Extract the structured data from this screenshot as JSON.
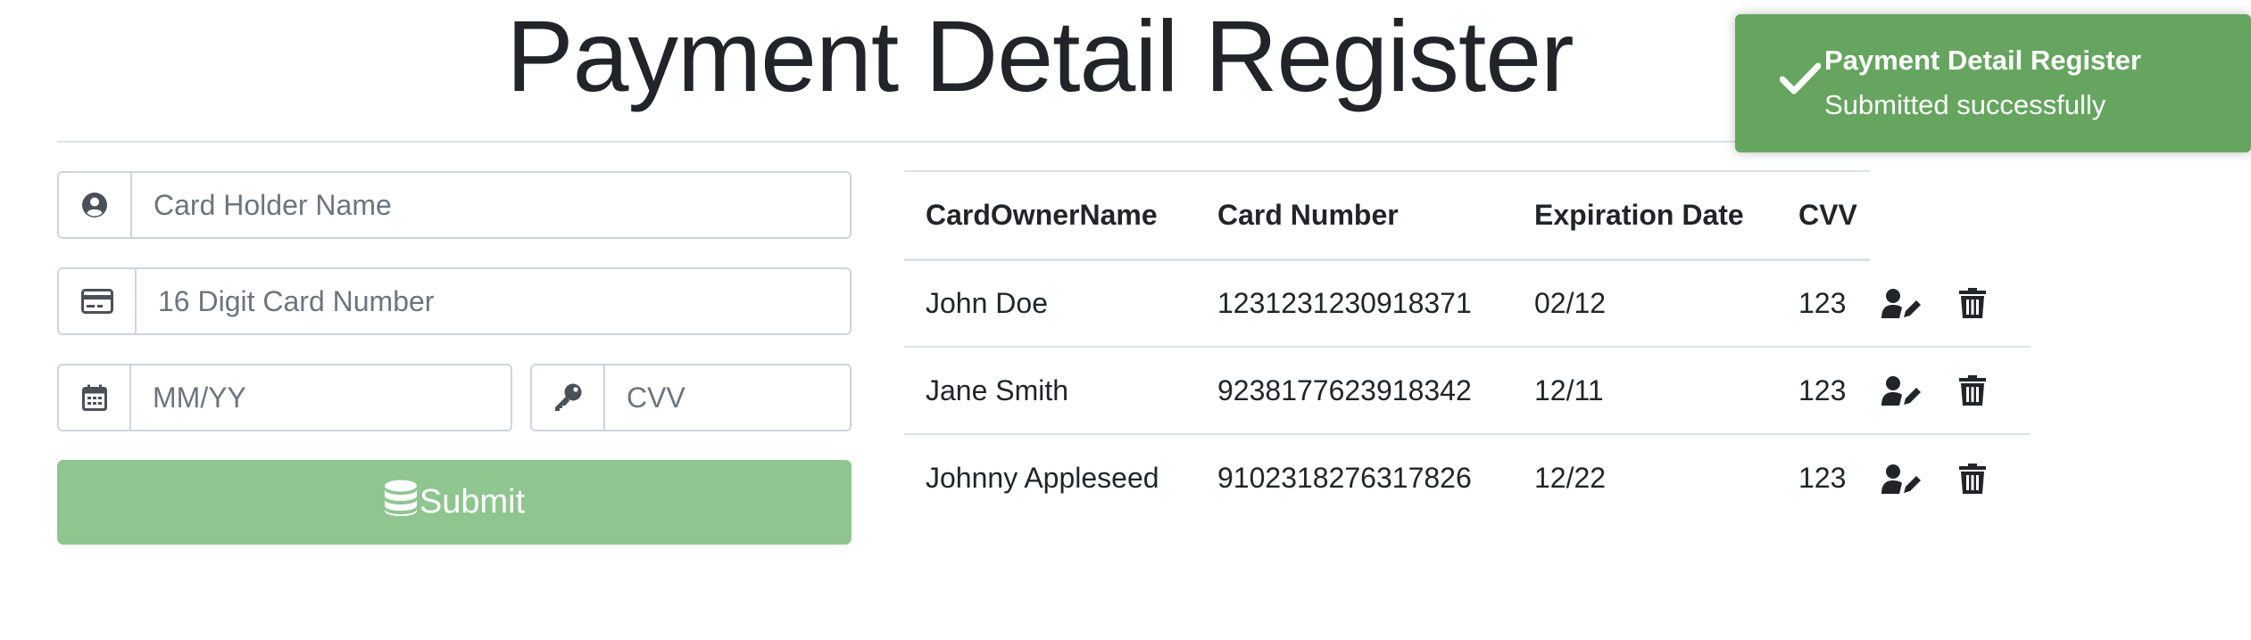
{
  "page": {
    "title": "Payment Detail Register"
  },
  "form": {
    "card_holder": {
      "placeholder": "Card Holder Name",
      "value": ""
    },
    "card_number": {
      "placeholder": "16 Digit Card Number",
      "value": ""
    },
    "expiry": {
      "placeholder": "MM/YY",
      "value": ""
    },
    "cvv": {
      "placeholder": "CVV",
      "value": ""
    },
    "submit_label": "Submit",
    "icons": [
      "user-circle-icon",
      "credit-card-icon",
      "calendar-icon",
      "key-icon",
      "database-icon"
    ]
  },
  "table": {
    "headers": [
      "CardOwnerName",
      "Card Number",
      "Expiration Date",
      "CVV"
    ],
    "rows": [
      {
        "owner": "John Doe",
        "number": "1231231230918371",
        "expiry": "02/12",
        "cvv": "123"
      },
      {
        "owner": "Jane Smith",
        "number": "9238177623918342",
        "expiry": "12/11",
        "cvv": "123"
      },
      {
        "owner": "Johnny Appleseed",
        "number": "9102318276317826",
        "expiry": "12/22",
        "cvv": "123"
      }
    ],
    "row_actions": [
      "user-edit-icon",
      "trash-icon"
    ]
  },
  "toast": {
    "title": "Payment Detail Register",
    "message": "Submitted successfully",
    "icon": "check-icon"
  },
  "colors": {
    "submit_button": "#8fc58f",
    "toast_background": "#65a55f",
    "text": "#212529",
    "border": "#ced4da"
  }
}
